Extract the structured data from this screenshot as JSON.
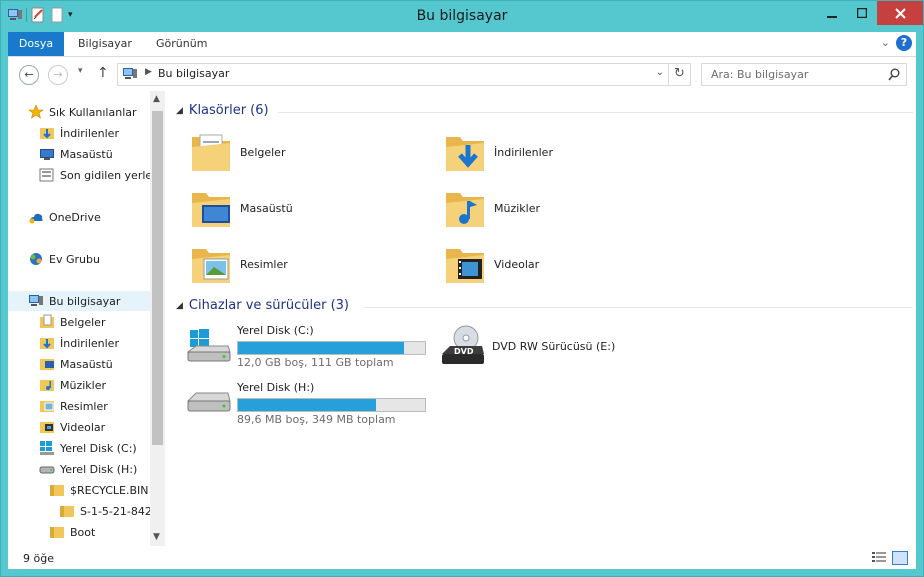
{
  "window": {
    "title": "Bu bilgisayar"
  },
  "ribbon": {
    "tabs": [
      "Dosya",
      "Bilgisayar",
      "Görünüm"
    ]
  },
  "address": {
    "location": "Bu bilgisayar",
    "search_placeholder": "Ara: Bu bilgisayar"
  },
  "nav": {
    "quick_access": "Sık Kullanılanlar",
    "quick_items": [
      "İndirilenler",
      "Masaüstü",
      "Son gidilen yerler"
    ],
    "onedrive": "OneDrive",
    "homegroup": "Ev Grubu",
    "this_pc": "Bu bilgisayar",
    "pc_items": [
      "Belgeler",
      "İndirilenler",
      "Masaüstü",
      "Müzikler",
      "Resimler",
      "Videolar",
      "Yerel Disk (C:)",
      "Yerel Disk (H:)"
    ],
    "sub_items": [
      "$RECYCLE.BIN",
      "S-1-5-21-842",
      "Boot"
    ]
  },
  "folders": {
    "heading": "Klasörler (6)",
    "items": [
      "Belgeler",
      "İndirilenler",
      "Masaüstü",
      "Müzikler",
      "Resimler",
      "Videolar"
    ]
  },
  "devices": {
    "heading": "Cihazlar ve sürücüler (3)",
    "drives": [
      {
        "name": "Yerel Disk (C:)",
        "info": "12,0 GB boş, 111 GB toplam",
        "used_fraction": 0.89
      },
      {
        "name": "Yerel Disk (H:)",
        "info": "89,6 MB boş, 349 MB toplam",
        "used_fraction": 0.74
      }
    ],
    "dvd": {
      "name": "DVD RW Sürücüsü (E:)",
      "badge": "DVD"
    }
  },
  "status": {
    "count": "9 öğe"
  },
  "colors": {
    "accent": "#1979ca",
    "window_frame": "#55c7cf",
    "bar_fill": "#26a0da",
    "close": "#c74040"
  }
}
